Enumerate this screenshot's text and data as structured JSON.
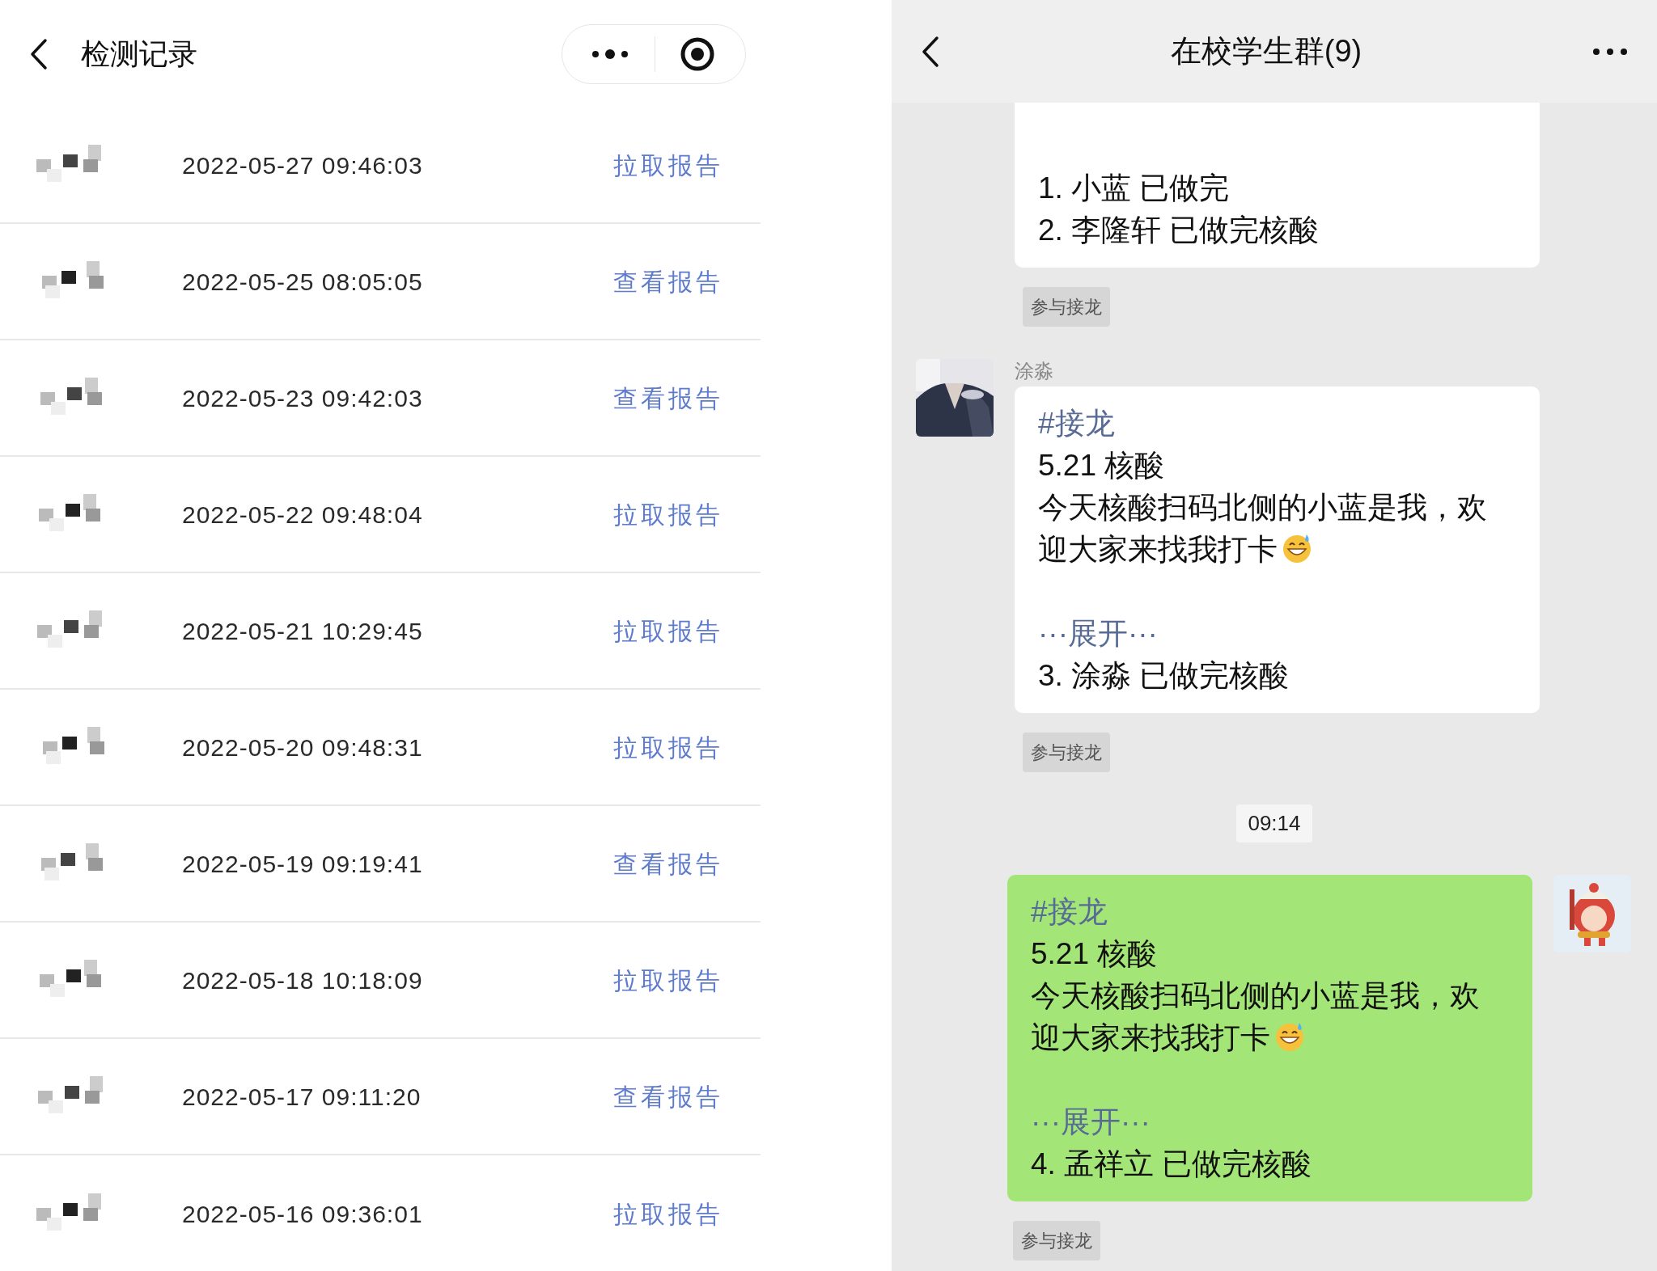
{
  "records": {
    "title": "检测记录",
    "rows": [
      {
        "date": "2022-05-27 09:46:03",
        "action": "拉取报告"
      },
      {
        "date": "2022-05-25 08:05:05",
        "action": "查看报告"
      },
      {
        "date": "2022-05-23 09:42:03",
        "action": "查看报告"
      },
      {
        "date": "2022-05-22 09:48:04",
        "action": "拉取报告"
      },
      {
        "date": "2022-05-21 10:29:45",
        "action": "拉取报告"
      },
      {
        "date": "2022-05-20 09:48:31",
        "action": "拉取报告"
      },
      {
        "date": "2022-05-19 09:19:41",
        "action": "查看报告"
      },
      {
        "date": "2022-05-18 10:18:09",
        "action": "拉取报告"
      },
      {
        "date": "2022-05-17 09:11:20",
        "action": "查看报告"
      },
      {
        "date": "2022-05-16 09:36:01",
        "action": "拉取报告"
      }
    ]
  },
  "chat": {
    "title": "在校学生群(9)",
    "items": [
      {
        "kind": "message",
        "outgoing": false,
        "clipped": true,
        "lines": [
          {
            "kind": "text",
            "text": "1. 小蓝 已做完"
          },
          {
            "kind": "text",
            "text": "2. 李隆轩 已做完核酸"
          }
        ],
        "join": "参与接龙"
      },
      {
        "kind": "message",
        "outgoing": false,
        "clipped": false,
        "sender": "涂淼",
        "lines": [
          {
            "kind": "tag",
            "text": "#接龙"
          },
          {
            "kind": "text",
            "text": "5.21 核酸"
          },
          {
            "kind": "emoji_text",
            "text": "今天核酸扫码北侧的小蓝是我，欢迎大家来找我打卡"
          },
          {
            "kind": "expand",
            "text": "···展开···"
          },
          {
            "kind": "text",
            "text": "3. 涂淼 已做完核酸"
          }
        ],
        "join": "参与接龙"
      },
      {
        "kind": "time",
        "text": "09:14"
      },
      {
        "kind": "message",
        "outgoing": true,
        "clipped": false,
        "lines": [
          {
            "kind": "tag",
            "text": "#接龙"
          },
          {
            "kind": "text",
            "text": "5.21 核酸"
          },
          {
            "kind": "emoji_text",
            "text": "今天核酸扫码北侧的小蓝是我，欢迎大家来找我打卡"
          },
          {
            "kind": "expand",
            "text": "···展开···"
          },
          {
            "kind": "text",
            "text": "4. 孟祥立 已做完核酸"
          }
        ],
        "join": "参与接龙"
      }
    ]
  }
}
